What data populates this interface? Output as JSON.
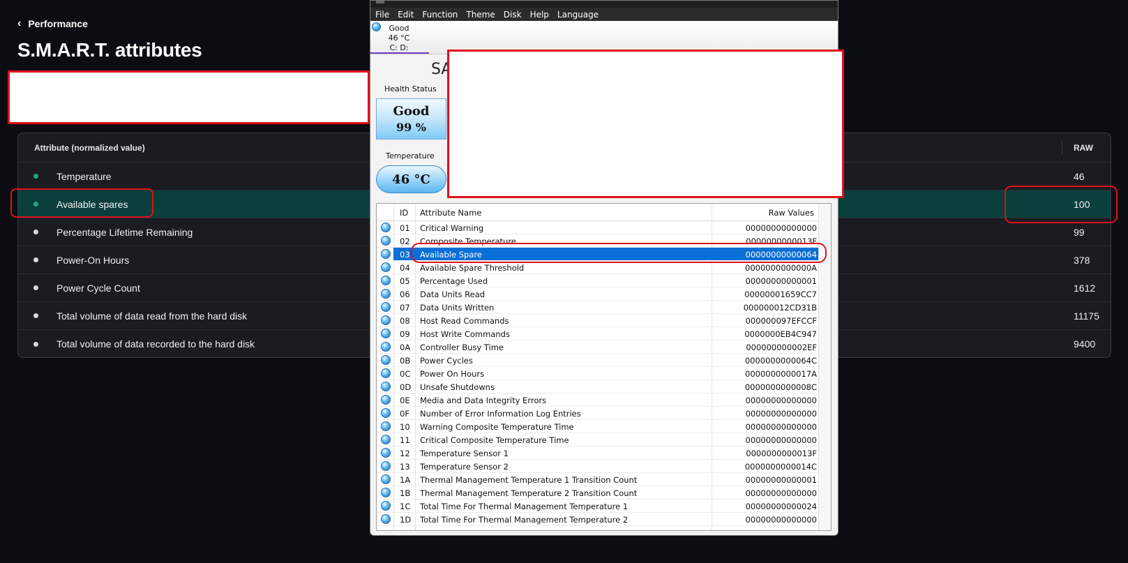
{
  "left_app": {
    "back_label": "Performance",
    "title": "S.M.A.R.T. attributes",
    "table": {
      "col_attribute": "Attribute (normalized value)",
      "col_raw": "RAW",
      "rows": [
        {
          "name": "Temperature",
          "raw": "46",
          "dot": "green"
        },
        {
          "name": "Available spares",
          "raw": "100",
          "dot": "green",
          "selected": true
        },
        {
          "name": "Percentage Lifetime Remaining",
          "raw": "99",
          "dot": "white"
        },
        {
          "name": "Power-On Hours",
          "raw": "378",
          "dot": "white"
        },
        {
          "name": "Power Cycle Count",
          "raw": "1612",
          "dot": "white"
        },
        {
          "name": "Total volume of data read from the hard disk",
          "raw": "11175",
          "dot": "white"
        },
        {
          "name": "Total volume of data recorded to the hard disk",
          "raw": "9400",
          "dot": "white"
        }
      ]
    }
  },
  "cdi": {
    "menu": [
      "File",
      "Edit",
      "Function",
      "Theme",
      "Disk",
      "Help",
      "Language"
    ],
    "drive": {
      "status": "Good",
      "temp": "46 °C",
      "letters": "C: D:"
    },
    "model_partial": "SA",
    "health_label": "Health Status",
    "health_status": "Good",
    "health_percent": "99 %",
    "temp_label": "Temperature",
    "temp_value": "46 °C",
    "table": {
      "col_id": "ID",
      "col_name": "Attribute Name",
      "col_raw": "Raw Values",
      "rows": [
        {
          "id": "01",
          "name": "Critical Warning",
          "raw": "00000000000000"
        },
        {
          "id": "02",
          "name": "Composite Temperature",
          "raw": "0000000000013F"
        },
        {
          "id": "03",
          "name": "Available Spare",
          "raw": "00000000000064",
          "selected": true
        },
        {
          "id": "04",
          "name": "Available Spare Threshold",
          "raw": "0000000000000A"
        },
        {
          "id": "05",
          "name": "Percentage Used",
          "raw": "00000000000001"
        },
        {
          "id": "06",
          "name": "Data Units Read",
          "raw": "00000001659CC7"
        },
        {
          "id": "07",
          "name": "Data Units Written",
          "raw": "000000012CD31B"
        },
        {
          "id": "08",
          "name": "Host Read Commands",
          "raw": "000000097EFCCF"
        },
        {
          "id": "09",
          "name": "Host Write Commands",
          "raw": "0000000EB4C947"
        },
        {
          "id": "0A",
          "name": "Controller Busy Time",
          "raw": "000000000002EF"
        },
        {
          "id": "0B",
          "name": "Power Cycles",
          "raw": "0000000000064C"
        },
        {
          "id": "0C",
          "name": "Power On Hours",
          "raw": "0000000000017A"
        },
        {
          "id": "0D",
          "name": "Unsafe Shutdowns",
          "raw": "0000000000008C"
        },
        {
          "id": "0E",
          "name": "Media and Data Integrity Errors",
          "raw": "00000000000000"
        },
        {
          "id": "0F",
          "name": "Number of Error Information Log Entries",
          "raw": "00000000000000"
        },
        {
          "id": "10",
          "name": "Warning Composite Temperature Time",
          "raw": "00000000000000"
        },
        {
          "id": "11",
          "name": "Critical Composite Temperature Time",
          "raw": "00000000000000"
        },
        {
          "id": "12",
          "name": "Temperature Sensor 1",
          "raw": "0000000000013F"
        },
        {
          "id": "13",
          "name": "Temperature Sensor 2",
          "raw": "0000000000014C"
        },
        {
          "id": "1A",
          "name": "Thermal Management Temperature 1 Transition Count",
          "raw": "00000000000001"
        },
        {
          "id": "1B",
          "name": "Thermal Management Temperature 2 Transition Count",
          "raw": "00000000000000"
        },
        {
          "id": "1C",
          "name": "Total Time For Thermal Management Temperature 1",
          "raw": "00000000000024"
        },
        {
          "id": "1D",
          "name": "Total Time For Thermal Management Temperature 2",
          "raw": "00000000000000"
        }
      ]
    }
  },
  "colors": {
    "accent_green": "#1fa585",
    "selection_teal": "#0b3f3c",
    "highlight_red": "#e0101a",
    "cdi_selection": "#0a6fd6"
  }
}
